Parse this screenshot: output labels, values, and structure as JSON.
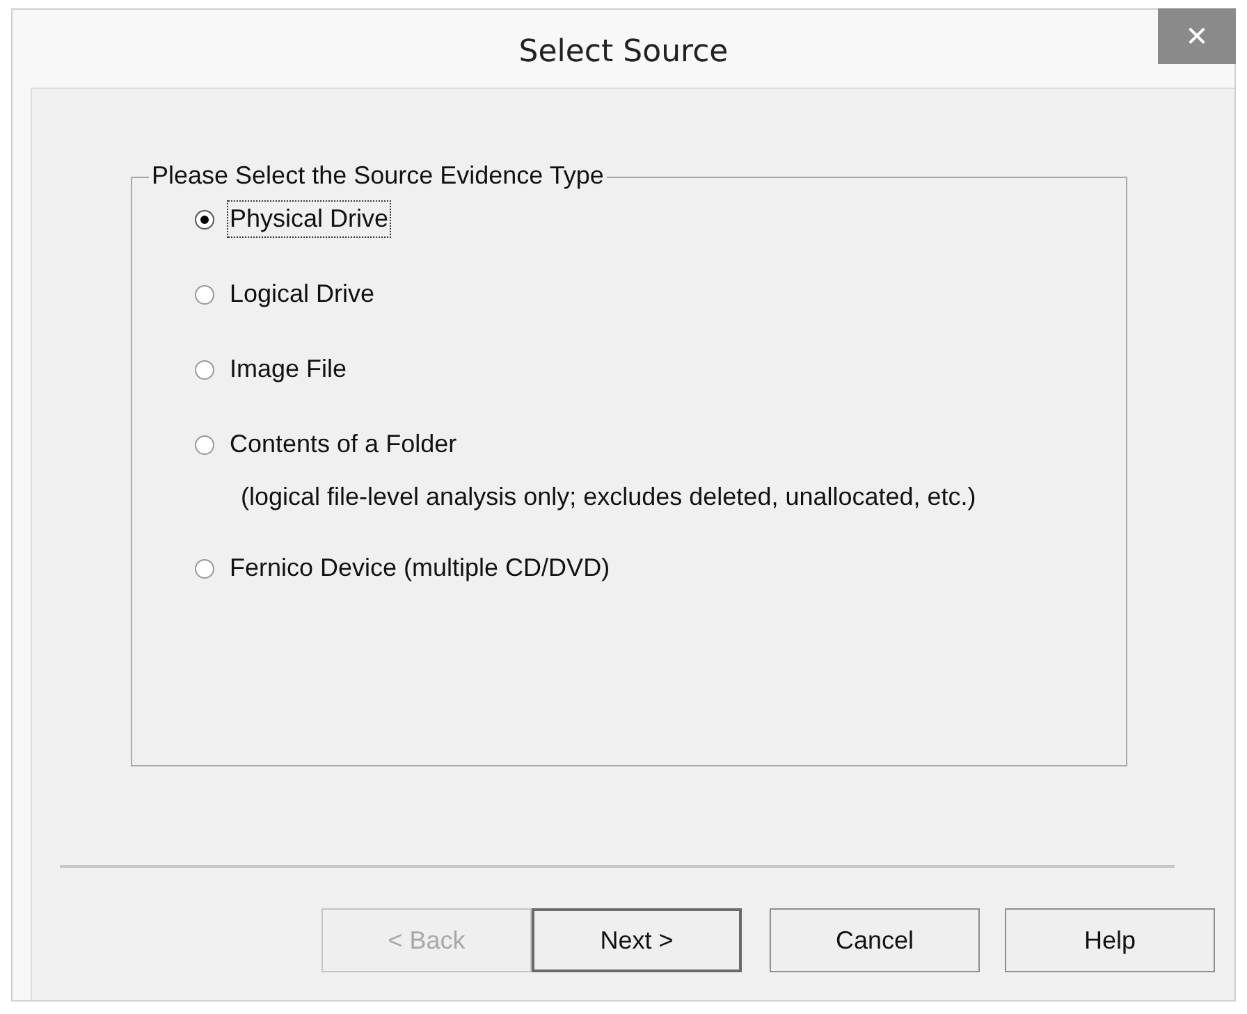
{
  "window": {
    "title": "Select Source",
    "close": "✕"
  },
  "group": {
    "legend": "Please Select the Source Evidence Type",
    "options": [
      {
        "label": "Physical Drive",
        "selected": true
      },
      {
        "label": "Logical Drive",
        "selected": false
      },
      {
        "label": "Image File",
        "selected": false
      },
      {
        "label": "Contents of a Folder",
        "selected": false,
        "note": "(logical file-level analysis only; excludes deleted, unallocated, etc.)"
      },
      {
        "label": "Fernico Device (multiple CD/DVD)",
        "selected": false
      }
    ]
  },
  "buttons": [
    {
      "label": "< Back",
      "disabled": true,
      "default": false
    },
    {
      "label": "Next >",
      "disabled": false,
      "default": true
    },
    {
      "label": "Cancel",
      "disabled": false,
      "default": false
    },
    {
      "label": "Help",
      "disabled": false,
      "default": false
    }
  ]
}
